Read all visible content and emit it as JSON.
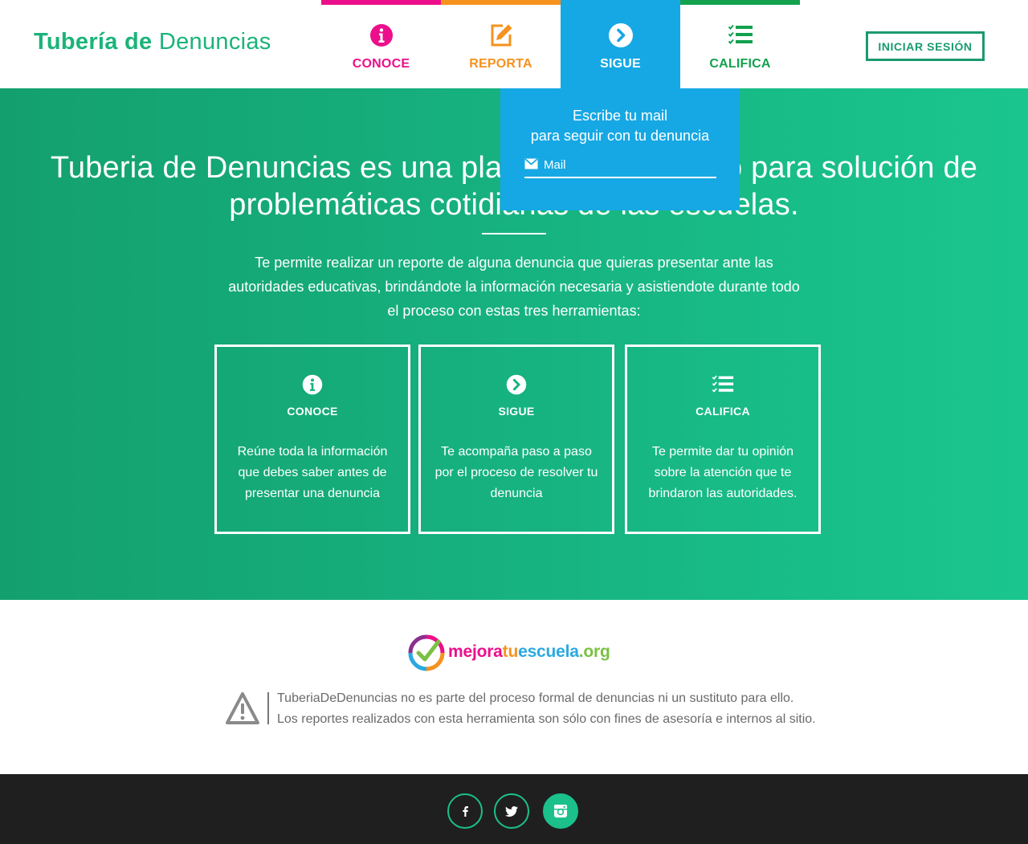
{
  "header": {
    "brand_bold": "Tubería de",
    "brand_light": "Denuncias",
    "nav": [
      {
        "label": "CONOCE",
        "color": "#ec0f8b",
        "icon": "info-icon"
      },
      {
        "label": "REPORTA",
        "color": "#f6921e",
        "icon": "edit-icon"
      },
      {
        "label": "SIGUE",
        "color": "#ffffff",
        "icon": "chevron-right-circle-icon",
        "active": true,
        "bg": "#16a8e4"
      },
      {
        "label": "CALIFICA",
        "color": "#13a14e",
        "icon": "checklist-icon"
      }
    ],
    "login_label": "INICIAR SESIÓN"
  },
  "dropdown": {
    "line1": "Escribe tu mail",
    "line2": "para seguir con tu denuncia",
    "mail_placeholder": "Mail"
  },
  "hero": {
    "title": "Tuberia de Denuncias es una plataforma de apoyo para solución de problemáticas cotidianas de las escuelas.",
    "description": "Te permite realizar un reporte de alguna denuncia que quieras presentar ante las autoridades educativas, brindándote la  información necesaria y asistiendote durante todo el proceso con estas tres herramientas:",
    "cards": [
      {
        "title": "CONOCE",
        "icon": "info-icon",
        "desc": "Reúne toda la información que debes saber antes de presentar una denuncia"
      },
      {
        "title": "SIGUE",
        "icon": "chevron-right-circle-icon",
        "desc": "Te acompaña paso a paso por el proceso de resolver tu denuncia"
      },
      {
        "title": "CALIFICA",
        "icon": "checklist-icon",
        "desc": "Te permite dar tu opinión sobre la atención que te brindaron las autoridades."
      }
    ]
  },
  "logo": {
    "part1": "mejora",
    "part2": "tu",
    "part3": "escuela",
    "part4": ".org"
  },
  "disclaimer": {
    "line1": "TuberiaDeDenuncias no es parte del proceso formal de denuncias ni un sustituto para ello.",
    "line2": "Los reportes realizados con esta herramienta son sólo con fines de asesoría e internos al sitio."
  },
  "footer": {
    "social": [
      "facebook-icon",
      "twitter-icon",
      "instagram-icon"
    ]
  },
  "colors": {
    "brand_green": "#1bb37a",
    "conoce": "#ec0f8b",
    "reporta": "#f6921e",
    "sigue": "#16a8e4",
    "califica": "#13a14e"
  }
}
